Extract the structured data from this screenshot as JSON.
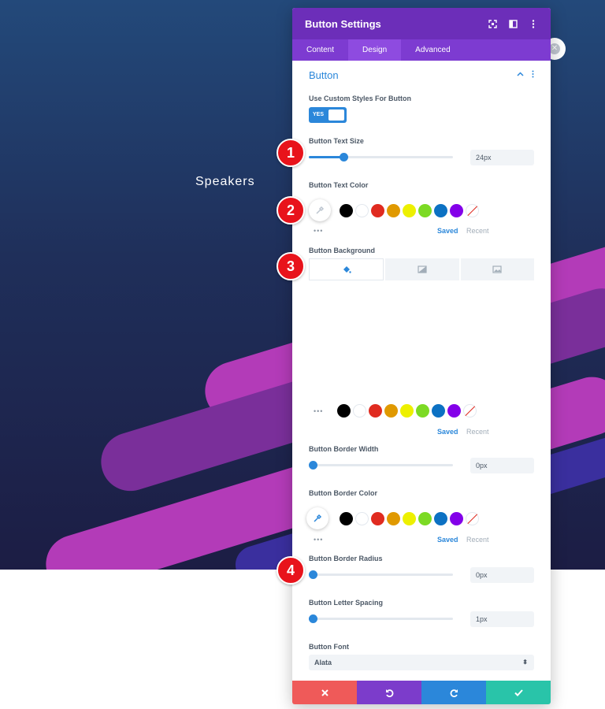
{
  "page": {
    "heading": "Speakers"
  },
  "panel": {
    "title": "Button Settings",
    "tabs": [
      {
        "label": "Content"
      },
      {
        "label": "Design"
      },
      {
        "label": "Advanced"
      }
    ],
    "section_title": "Button"
  },
  "fields": {
    "custom_styles": {
      "label": "Use Custom Styles For Button",
      "toggle": "YES"
    },
    "text_size": {
      "label": "Button Text Size",
      "value": "24px",
      "fraction": 0.24
    },
    "text_color": {
      "label": "Button Text Color"
    },
    "background": {
      "label": "Button Background"
    },
    "border_width": {
      "label": "Button Border Width",
      "value": "0px",
      "fraction": 0.0
    },
    "border_color": {
      "label": "Button Border Color"
    },
    "border_radius": {
      "label": "Button Border Radius",
      "value": "0px",
      "fraction": 0.0
    },
    "letter_spacing": {
      "label": "Button Letter Spacing",
      "value": "1px",
      "fraction": 0.01
    },
    "font": {
      "label": "Button Font",
      "value": "Alata"
    }
  },
  "palette": {
    "colors": [
      "#000000",
      "#ffffff",
      "#e02b20",
      "#e09900",
      "#edf000",
      "#7cda24",
      "#0c71c3",
      "#8300e9"
    ],
    "saved": "Saved",
    "recent": "Recent",
    "more": "•••"
  },
  "markers": [
    "1",
    "2",
    "3",
    "4"
  ],
  "colors": {
    "header": "#6c2eb9",
    "accent": "#2b87da",
    "cancel": "#ef5a59",
    "undo": "#7c3ccb",
    "redo": "#2b87da",
    "save": "#29c4a9"
  }
}
